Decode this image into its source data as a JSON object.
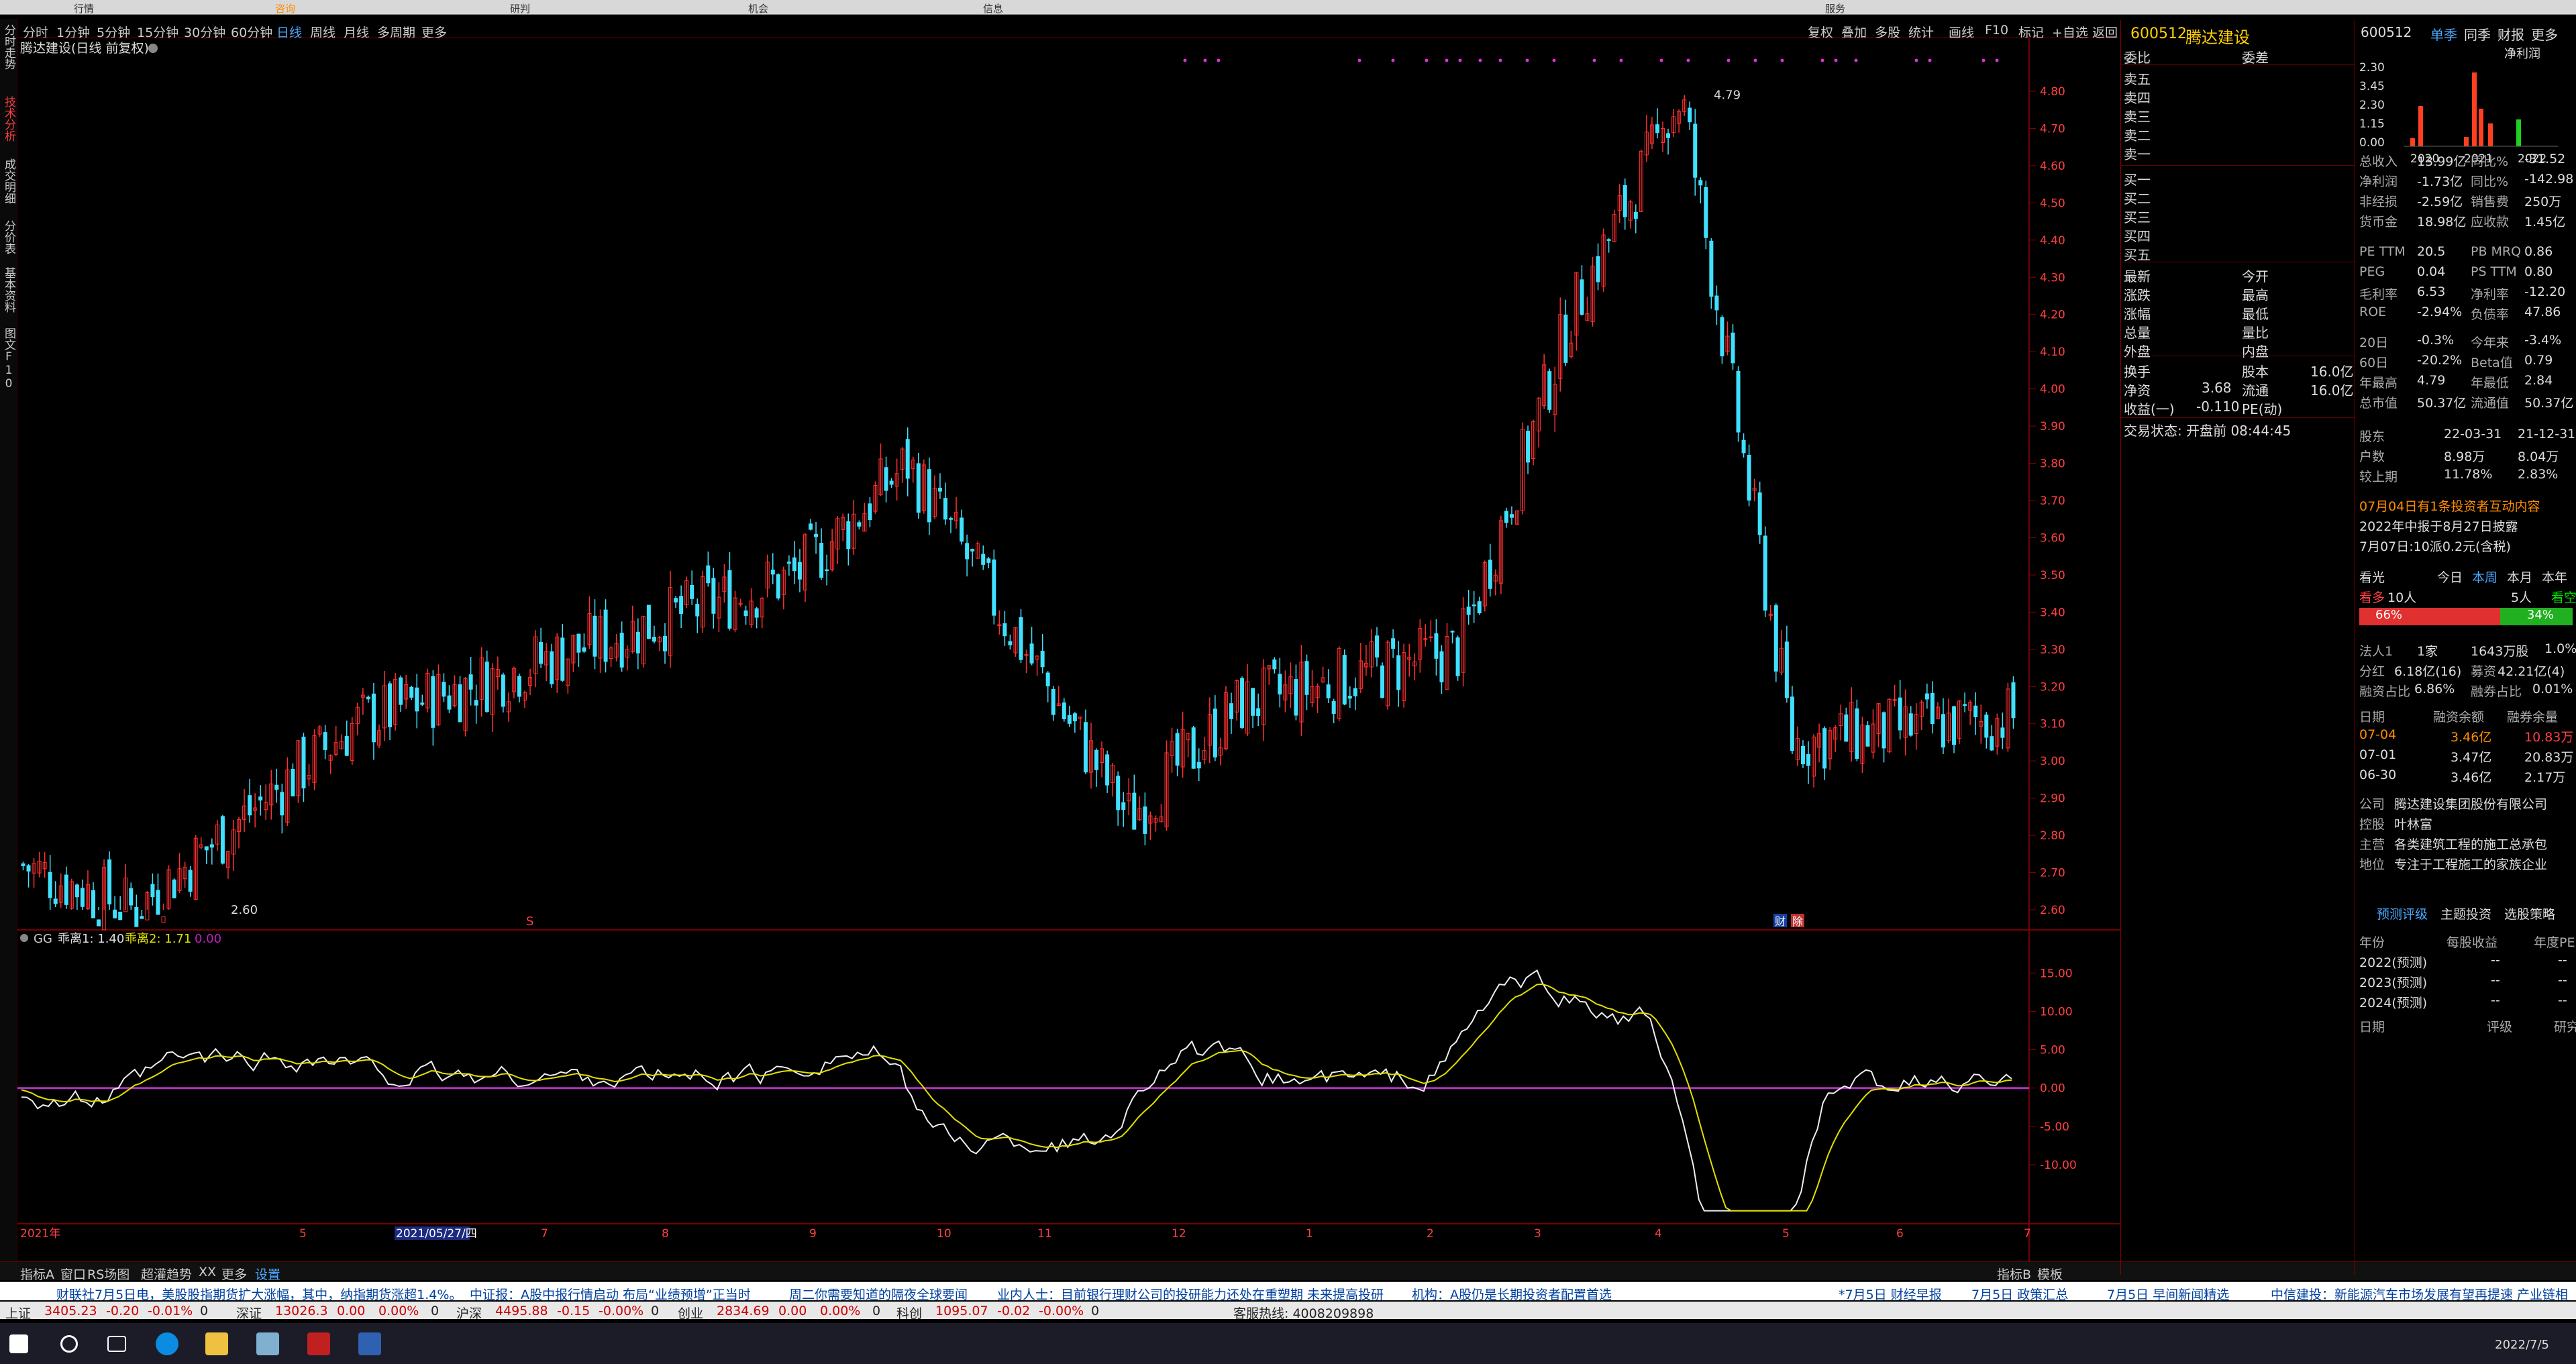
{
  "menubar": [
    "行情",
    "咨询",
    "研判",
    "机会",
    "信息",
    "服务"
  ],
  "timeframes": [
    "分时",
    "1分钟",
    "5分钟",
    "15分钟",
    "30分钟",
    "60分钟",
    "日线",
    "周线",
    "月线",
    "多周期",
    "更多"
  ],
  "active_timeframe": "日线",
  "toolbar": [
    "复权",
    "叠加",
    "多股",
    "统计",
    "画线",
    "F10",
    "标记",
    "+自选",
    "返回"
  ],
  "left_tabs": [
    "分时走势",
    "技术分析",
    "成交明细",
    "分价表",
    "基本资料",
    "图文F10"
  ],
  "active_left_tab": "技术分析",
  "chart_title": "腾达建设(日线 前复权)",
  "price_axis": [
    "4.80",
    "4.70",
    "4.60",
    "4.50",
    "4.40",
    "4.30",
    "4.20",
    "4.10",
    "4.00",
    "3.90",
    "3.80",
    "3.70",
    "3.60",
    "3.50",
    "3.40",
    "3.30",
    "3.20",
    "3.10",
    "3.00",
    "2.90",
    "2.80",
    "2.70",
    "2.60"
  ],
  "max_label": "4.79",
  "min_label": "2.60",
  "indicator_legend": {
    "name": "GG",
    "l1": "乖离1: 1.40",
    "l2": "乖离2: 1.71",
    "l3": "0.00"
  },
  "ind_axis": [
    "15.00",
    "10.00",
    "5.00",
    "0.00",
    "-5.00",
    "-10.00"
  ],
  "x_axis": [
    "2021年",
    "5",
    "2021/05/27/四",
    "7",
    "8",
    "9",
    "10",
    "11",
    "12",
    "1",
    "2",
    "3",
    "4",
    "5",
    "6",
    "7"
  ],
  "chart_marks": {
    "fin": "财",
    "ex": "除"
  },
  "bottom_tabs": [
    "指标A",
    "窗口",
    "RS场图",
    "超灌趋势",
    "XX",
    "更多",
    "设置",
    "指标B",
    "模板"
  ],
  "chart_data": {
    "type": "candlestick",
    "title": "腾达建设(日线 前复权)",
    "ylim": [
      2.55,
      4.83
    ],
    "x_range": [
      "2021-01",
      "2022-07"
    ],
    "key_points": [
      {
        "date": "2021-01",
        "price": 2.72
      },
      {
        "date": "2021-02",
        "price": 2.6
      },
      {
        "date": "2021-04",
        "price": 3.1
      },
      {
        "date": "2021-08",
        "price": 3.5
      },
      {
        "date": "2021-09",
        "price": 3.8
      },
      {
        "date": "2021-11",
        "price": 2.85
      },
      {
        "date": "2021-12",
        "price": 3.15
      },
      {
        "date": "2022-02",
        "price": 3.3
      },
      {
        "date": "2022-03",
        "price": 4.2
      },
      {
        "date": "2022-04",
        "price": 4.79
      },
      {
        "date": "2022-05",
        "price": 3.05
      },
      {
        "date": "2022-07",
        "price": 3.12
      }
    ],
    "indicator": {
      "name": "GG",
      "series": [
        {
          "name": "乖离1",
          "value": 1.4
        },
        {
          "name": "乖离2",
          "value": 1.71
        }
      ],
      "ylim": [
        -17,
        18
      ]
    }
  },
  "quote": {
    "code": "600512",
    "name": "腾达建设",
    "weibi": "委比",
    "weicha": "委差",
    "sell": [
      "卖五",
      "卖四",
      "卖三",
      "卖二",
      "卖一"
    ],
    "buy": [
      "买一",
      "买二",
      "买三",
      "买四",
      "买五"
    ],
    "left_labels": [
      "最新",
      "涨跌",
      "涨幅",
      "总量",
      "外盘"
    ],
    "right_labels": [
      "今开",
      "最高",
      "最低",
      "量比",
      "内盘"
    ],
    "turnover_label": "换手",
    "share_label": "股本",
    "share_val": "16.0亿",
    "net_label": "净资",
    "net_val": "3.68",
    "float_label": "流通",
    "float_val": "16.0亿",
    "eps_label": "收益(一)",
    "eps_val": "-0.110",
    "pe_label": "PE(动)",
    "status": "交易状态: 开盘前 08:44:45"
  },
  "f10": {
    "code": "600512",
    "tabs": [
      "单季",
      "同季",
      "财报",
      "更多"
    ],
    "profit_label": "净利润",
    "bar_axis": [
      "2.30",
      "3.45",
      "2.30",
      "1.15",
      "0.00"
    ],
    "bar_years": [
      "2020",
      "2021",
      "2022"
    ],
    "rows1": [
      {
        "l": "总收入",
        "v": "13.99亿",
        "l2": "同比%",
        "v2": "-31.52"
      },
      {
        "l": "净利润",
        "v": "-1.73亿",
        "l2": "同比%",
        "v2": "-142.98"
      },
      {
        "l": "非经损",
        "v": "-2.59亿",
        "l2": "销售费",
        "v2": "250万"
      },
      {
        "l": "货币金",
        "v": "18.98亿",
        "l2": "应收款",
        "v2": "1.45亿"
      }
    ],
    "rows2": [
      {
        "l": "PE TTM",
        "v": "20.5",
        "l2": "PB MRQ",
        "v2": "0.86"
      },
      {
        "l": "PEG",
        "v": "0.04",
        "l2": "PS TTM",
        "v2": "0.80"
      },
      {
        "l": "毛利率",
        "v": "6.53",
        "l2": "净利率",
        "v2": "-12.20"
      },
      {
        "l": "ROE",
        "v": "-2.94%",
        "l2": "负债率",
        "v2": "47.86"
      }
    ],
    "rows3": [
      {
        "l": "20日",
        "v": "-0.3%",
        "l2": "今年来",
        "v2": "-3.4%"
      },
      {
        "l": "60日",
        "v": "-20.2%",
        "l2": "Beta值",
        "v2": "0.79"
      },
      {
        "l": "年最高",
        "v": "4.79",
        "l2": "年最低",
        "v2": "2.84"
      },
      {
        "l": "总市值",
        "v": "50.37亿",
        "l2": "流通值",
        "v2": "50.37亿"
      }
    ],
    "rows4": [
      {
        "l": "股东",
        "v": "22-03-31",
        "v2": "21-12-31"
      },
      {
        "l": "户数",
        "v": "8.98万",
        "v2": "8.04万"
      },
      {
        "l": "较上期",
        "v": "11.78%",
        "v2": "2.83%"
      }
    ],
    "news1": "07月04日有1条投资者互动内容",
    "news2": "2022年中报于8月27日披露",
    "news3": "7月07日:10派0.2元(含税)",
    "sentiment_label": "看光",
    "sent_tabs": [
      "今日",
      "本周",
      "本月",
      "本年"
    ],
    "bull_label": "看多",
    "bull_count": "10人",
    "bear_count": "5人",
    "bear_label": "看空",
    "bull_pct": "66%",
    "bear_pct": "34%",
    "holder": {
      "l": "法人1",
      "v": "1家",
      "v2": "1643万股",
      "v3": "1.0%"
    },
    "div": {
      "l": "分红",
      "v": "6.18亿(16)",
      "l2": "募资",
      "v2": "42.21亿(4)"
    },
    "margin_ratio": {
      "l": "融资占比",
      "v": "6.86%",
      "l2": "融券占比",
      "v2": "0.01%"
    },
    "margin_head": [
      "日期",
      "融资余额",
      "融券余量"
    ],
    "margin_rows": [
      {
        "d": "07-04",
        "a": "3.46亿",
        "b": "10.83万"
      },
      {
        "d": "07-01",
        "a": "3.47亿",
        "b": "20.83万"
      },
      {
        "d": "06-30",
        "a": "3.46亿",
        "b": "2.17万"
      }
    ],
    "company": [
      {
        "l": "公司",
        "v": "腾达建设集团股份有限公司"
      },
      {
        "l": "控股",
        "v": "叶林富"
      },
      {
        "l": "主营",
        "v": "各类建筑工程的施工总承包"
      },
      {
        "l": "地位",
        "v": "专注于工程施工的家族企业"
      }
    ],
    "forecast_tabs": [
      "预测评级",
      "主题投资",
      "选股策略"
    ],
    "forecast_head": [
      "年份",
      "每股收益",
      "年度PE"
    ],
    "forecast_rows": [
      {
        "y": "2022(预测)",
        "a": "--",
        "b": "--"
      },
      {
        "y": "2023(预测)",
        "a": "--",
        "b": "--"
      },
      {
        "y": "2024(预测)",
        "a": "--",
        "b": "--"
      }
    ],
    "rating_head": [
      "日期",
      "评级",
      "研究机构"
    ]
  },
  "ticker": [
    "财联社7月5日电，美股股指期货扩大涨幅，其中，纳指期货涨超1.4%。",
    "中证报：A股中报行情启动 布局“业绩预增”正当时",
    "周二你需要知道的隔夜全球要闻",
    "业内人士：目前银行理财公司的投研能力还处在重塑期 未来提高投研",
    "机构：A股仍是长期投资者配置首选",
    "*7月5日 财经早报",
    "7月5日 政策汇总",
    "7月5日 早间新闻精选",
    "中信建投：新能源汽车市场发展有望再提速 产业链相关公"
  ],
  "indices": [
    {
      "n": "上证",
      "p": "3405.23",
      "c": "-0.20",
      "pct": "-0.01%",
      "v": "0"
    },
    {
      "n": "深证",
      "p": "13026.3",
      "c": "0.00",
      "pct": "0.00%",
      "v": "0"
    },
    {
      "n": "沪深",
      "p": "4495.88",
      "c": "-0.15",
      "pct": "-0.00%",
      "v": "0"
    },
    {
      "n": "创业",
      "p": "2834.69",
      "c": "0.00",
      "pct": "0.00%",
      "v": "0"
    },
    {
      "n": "科创",
      "p": "1095.07",
      "c": "-0.02",
      "pct": "-0.00%",
      "v": "0"
    }
  ],
  "hotline": "客服热线: 4008209898",
  "datetime": "2022/7/5"
}
